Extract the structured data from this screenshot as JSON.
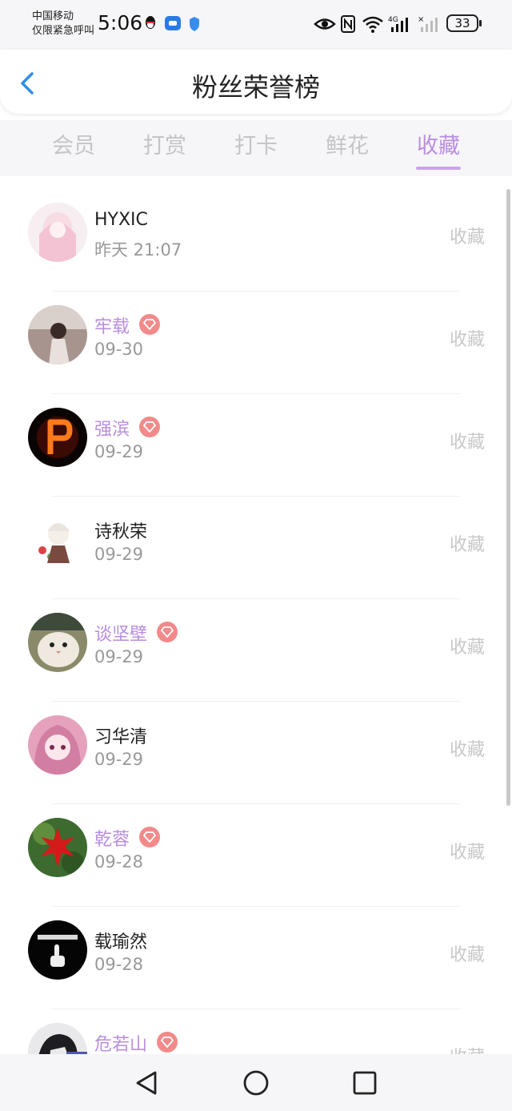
{
  "status": {
    "carrier_line1": "中国移动",
    "carrier_line2": "仅限紧急呼叫",
    "time": "5:06",
    "battery": "33",
    "network": "4G"
  },
  "header": {
    "title": "粉丝荣誉榜",
    "back_icon": "chevron-left-icon"
  },
  "tabs": [
    "会员",
    "打赏",
    "打卡",
    "鲜花",
    "收藏"
  ],
  "active_tab": "收藏",
  "accent_color": "#b98de0",
  "vip_badge_color": "#f28a8a",
  "fans": [
    {
      "name": "HYXIC",
      "date": "昨天 21:07",
      "action": "收藏",
      "vip": false,
      "avatar": "anime-girl-pink"
    },
    {
      "name": "牢载",
      "date": "09-30",
      "action": "收藏",
      "vip": true,
      "avatar": "photo-girl"
    },
    {
      "name": "强滨",
      "date": "09-29",
      "action": "收藏",
      "vip": true,
      "avatar": "fire-letter-p"
    },
    {
      "name": "诗秋荣",
      "date": "09-29",
      "action": "收藏",
      "vip": false,
      "avatar": "anime-girl-flowers"
    },
    {
      "name": "谈坚壁",
      "date": "09-29",
      "action": "收藏",
      "vip": true,
      "avatar": "fluffy-cat"
    },
    {
      "name": "习华清",
      "date": "09-29",
      "action": "收藏",
      "vip": false,
      "avatar": "anime-girl-pink-hair"
    },
    {
      "name": "乾蓉",
      "date": "09-28",
      "action": "收藏",
      "vip": true,
      "avatar": "red-maple-leaf"
    },
    {
      "name": "载瑜然",
      "date": "09-28",
      "action": "收藏",
      "vip": false,
      "avatar": "hand-gesture-black"
    },
    {
      "name": "危若山",
      "date": "",
      "action": "收藏",
      "vip": true,
      "avatar": "anime-boy"
    }
  ],
  "nav": {
    "back": "triangle-back-icon",
    "home": "circle-home-icon",
    "recent": "square-recent-icon"
  }
}
